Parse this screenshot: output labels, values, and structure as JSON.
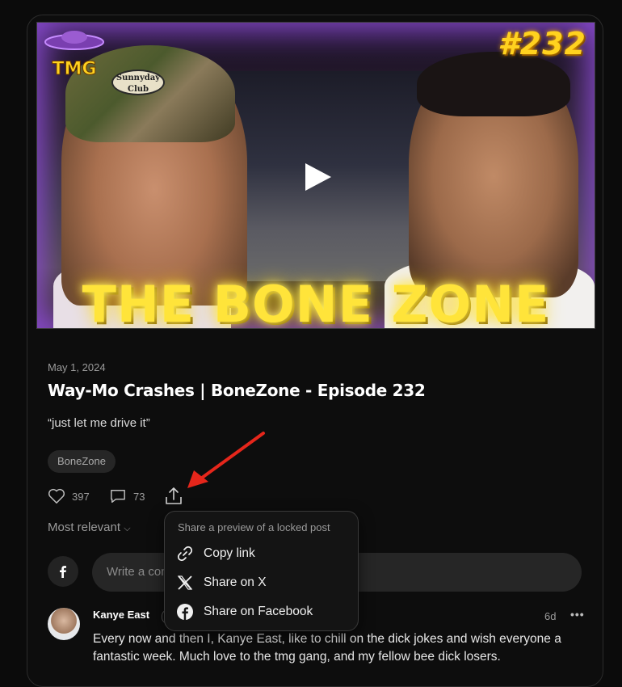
{
  "thumbnail": {
    "episode_badge": "#232",
    "logo_text": "TMG",
    "cap_text": "Sunnyday Club",
    "show_title": "THE BONE ZONE"
  },
  "post": {
    "date": "May 1, 2024",
    "title": "Way-Mo Crashes | BoneZone - Episode 232",
    "subtitle": "“just let me drive it”",
    "tag": "BoneZone",
    "likes": "397",
    "comments": "73"
  },
  "sort": {
    "label": "Most relevant"
  },
  "comment_box": {
    "placeholder": "Write a comment..."
  },
  "share_menu": {
    "hint": "Share a preview of a locked post",
    "items": [
      {
        "label": "Copy link",
        "icon": "link-icon"
      },
      {
        "label": "Share on X",
        "icon": "x-logo-icon"
      },
      {
        "label": "Share on Facebook",
        "icon": "facebook-icon"
      }
    ]
  },
  "comment": {
    "author": "Kanye East",
    "age": "6d",
    "more": "•••",
    "text": "Every now and then I, Kanye East, like to chill on the dick jokes and wish everyone a fantastic week. Much love to the tmg gang, and my fellow bee dick losers."
  },
  "colors": {
    "accent_arrow": "#e5261b",
    "title_yellow": "#ffe43a"
  }
}
